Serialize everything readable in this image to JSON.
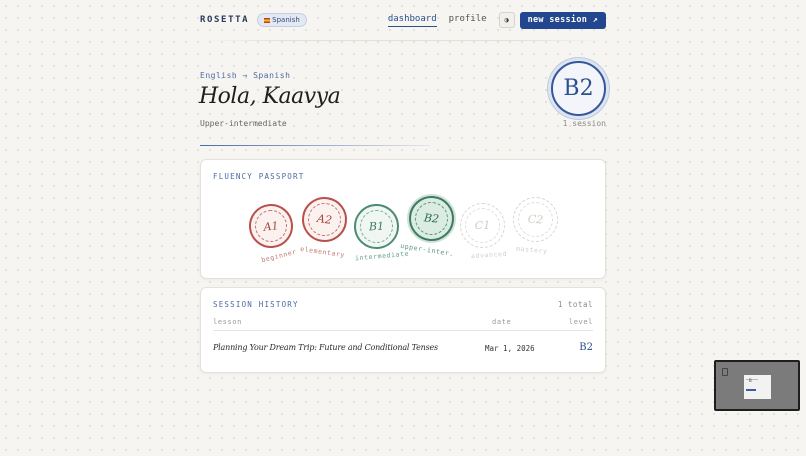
{
  "header": {
    "brand": "ROSETTA",
    "language_pill": "Spanish",
    "nav": {
      "dashboard": "dashboard",
      "profile": "profile"
    },
    "theme_toggle_glyph": "◑",
    "new_session": "new session ↗"
  },
  "hero": {
    "kicker": "English → Spanish",
    "greeting": "Hola, Kaavya",
    "level_name": "Upper-intermediate",
    "level_code": "B2",
    "session_count": "1 session"
  },
  "passport": {
    "title": "FLUENCY PASSPORT",
    "stamps": [
      {
        "code": "A1",
        "label": "beginner",
        "state": "earned"
      },
      {
        "code": "A2",
        "label": "elementary",
        "state": "earned"
      },
      {
        "code": "B1",
        "label": "intermediate",
        "state": "earned"
      },
      {
        "code": "B2",
        "label": "upper-inter.",
        "state": "current"
      },
      {
        "code": "C1",
        "label": "advanced",
        "state": "locked"
      },
      {
        "code": "C2",
        "label": "mastery",
        "state": "locked"
      }
    ]
  },
  "history": {
    "title": "SESSION HISTORY",
    "total": "1 total",
    "columns": {
      "lesson": "lesson",
      "date": "date",
      "level": "level"
    },
    "rows": [
      {
        "lesson": "Planning Your Dream Trip: Future and Conditional Tenses",
        "date": "Mar 1, 2026",
        "level": "B2"
      }
    ]
  },
  "thumbnail": {
    "label": "B"
  },
  "colors": {
    "accent": "#23478f",
    "earned_red": "#b9504a",
    "earned_green": "#4d8c73",
    "background": "#f6f5f1"
  }
}
